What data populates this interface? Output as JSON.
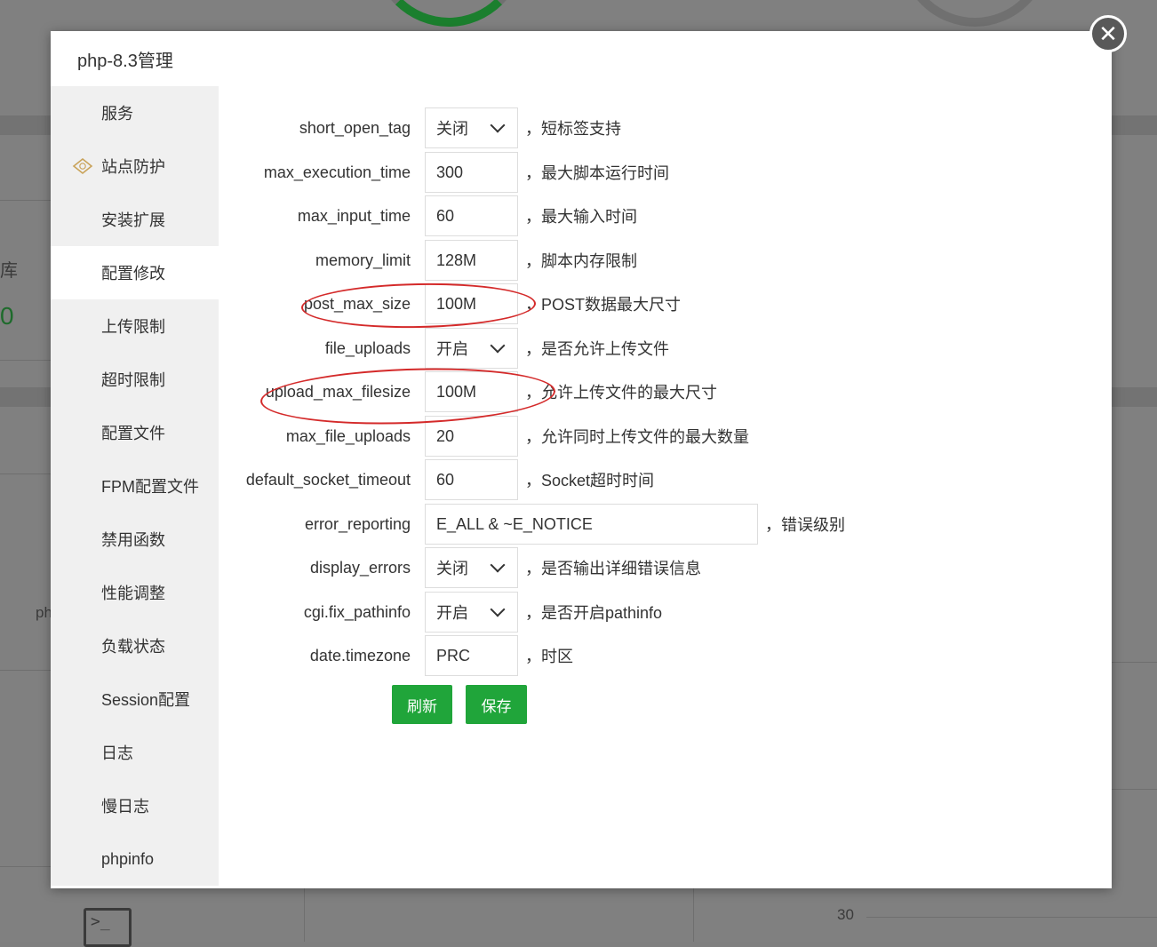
{
  "background": {
    "side_text_1": "库",
    "side_text_2": "0",
    "side_text_3": "ph",
    "axis_tick": "30"
  },
  "modal": {
    "title": "php-8.3管理",
    "close_glyph": "✕"
  },
  "sidebar": {
    "items": [
      {
        "label": "服务"
      },
      {
        "label": "站点防护"
      },
      {
        "label": "安装扩展"
      },
      {
        "label": "配置修改"
      },
      {
        "label": "上传限制"
      },
      {
        "label": "超时限制"
      },
      {
        "label": "配置文件"
      },
      {
        "label": "FPM配置文件"
      },
      {
        "label": "禁用函数"
      },
      {
        "label": "性能调整"
      },
      {
        "label": "负载状态"
      },
      {
        "label": "Session配置"
      },
      {
        "label": "日志"
      },
      {
        "label": "慢日志"
      },
      {
        "label": "phpinfo"
      }
    ],
    "active_index": 3
  },
  "config": {
    "rows": [
      {
        "key": "short_open_tag",
        "type": "select",
        "value": "关闭",
        "desc": "，短标签支持"
      },
      {
        "key": "max_execution_time",
        "type": "input",
        "value": "300",
        "desc": "，最大脚本运行时间"
      },
      {
        "key": "max_input_time",
        "type": "input",
        "value": "60",
        "desc": "，最大输入时间"
      },
      {
        "key": "memory_limit",
        "type": "input",
        "value": "128M",
        "desc": "，脚本内存限制"
      },
      {
        "key": "post_max_size",
        "type": "input",
        "value": "100M",
        "desc": "，POST数据最大尺寸"
      },
      {
        "key": "file_uploads",
        "type": "select",
        "value": "开启",
        "desc": "，是否允许上传文件"
      },
      {
        "key": "upload_max_filesize",
        "type": "input",
        "value": "100M",
        "desc": "，允许上传文件的最大尺寸"
      },
      {
        "key": "max_file_uploads",
        "type": "input",
        "value": "20",
        "desc": "，允许同时上传文件的最大数量"
      },
      {
        "key": "default_socket_timeout",
        "type": "input",
        "value": "60",
        "desc": "，Socket超时时间"
      },
      {
        "key": "error_reporting",
        "type": "input-wide",
        "value": "E_ALL & ~E_NOTICE",
        "desc": "，错误级别"
      },
      {
        "key": "display_errors",
        "type": "select",
        "value": "关闭",
        "desc": "，是否输出详细错误信息"
      },
      {
        "key": "cgi.fix_pathinfo",
        "type": "select",
        "value": "开启",
        "desc": "，是否开启pathinfo"
      },
      {
        "key": "date.timezone",
        "type": "input",
        "value": "PRC",
        "desc": "，时区"
      }
    ]
  },
  "buttons": {
    "refresh": "刷新",
    "save": "保存"
  },
  "annotation_color": "#d42a2a",
  "accent_color": "#20a53a"
}
